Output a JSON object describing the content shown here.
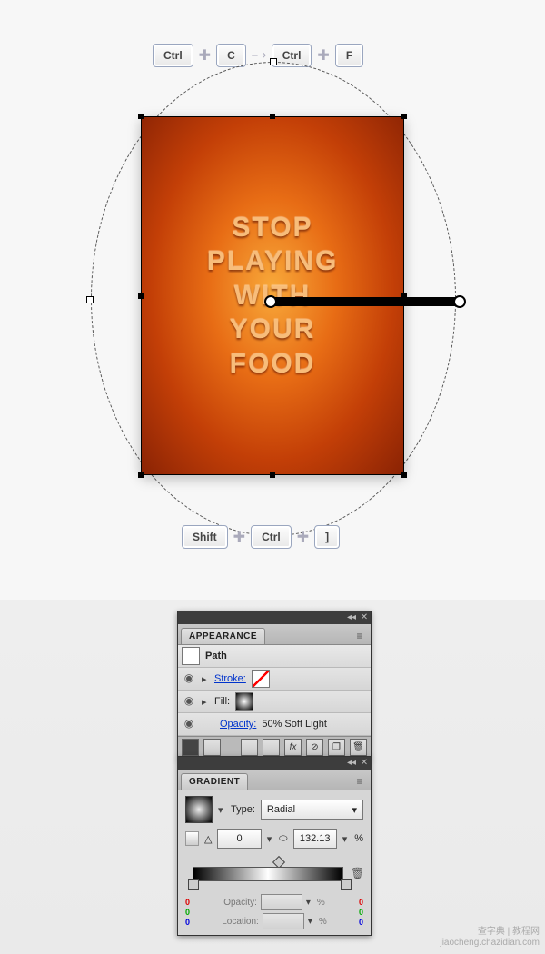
{
  "artwork": {
    "line1": "STOP",
    "line2": "PLAYING",
    "line3": "WITH",
    "line4": "YOUR",
    "line5": "FOOD"
  },
  "shortcuts": {
    "top": {
      "k1": "Ctrl",
      "k2": "C",
      "k3": "Ctrl",
      "k4": "F"
    },
    "bottom": {
      "k1": "Shift",
      "k2": "Ctrl",
      "k3": "]"
    }
  },
  "appearance": {
    "title": "APPEARANCE",
    "target": "Path",
    "stroke_label": "Stroke:",
    "fill_label": "Fill:",
    "opacity_label": "Opacity:",
    "opacity_value": "50% Soft Light"
  },
  "gradient": {
    "title": "GRADIENT",
    "type_label": "Type:",
    "type_value": "Radial",
    "angle_value": "0",
    "ratio_value": "132.13",
    "ratio_unit": "%",
    "opacity_label": "Opacity:",
    "opacity_unit": "%",
    "location_label": "Location:",
    "location_unit": "%",
    "stops": {
      "left": {
        "r": "0",
        "g": "0",
        "b": "0",
        "position": 0
      },
      "right": {
        "r": "0",
        "g": "0",
        "b": "0",
        "position": 100
      }
    }
  },
  "glyphs": {
    "plus": "✚",
    "arrow": "⤍",
    "eye": "◉",
    "tri": "▸",
    "caret": "▾",
    "fx": "fx",
    "menu": "≡",
    "min": "◂◂",
    "close": "✕",
    "trash": "🗑",
    "angle": "△",
    "ratio": "⬭"
  },
  "watermark": {
    "l1": "查字典 | 教程网",
    "l2": "jiaocheng.chazidian.com"
  }
}
